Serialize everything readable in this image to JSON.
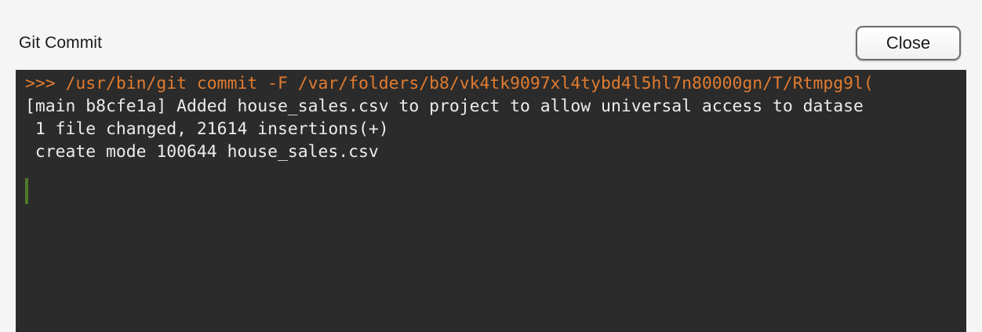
{
  "window": {
    "title": "Git Commit",
    "close_label": "Close"
  },
  "console": {
    "lines": [
      ">>> /usr/bin/git commit -F /var/folders/b8/vk4tk9097xl4tybd4l5hl7n80000gn/T/Rtmpg9l(",
      "[main b8cfe1a] Added house_sales.csv to project to allow universal access to datase",
      " 1 file changed, 21614 insertions(+)",
      " create mode 100644 house_sales.csv"
    ],
    "colors": {
      "background": "#2b2b2b",
      "command": "#e07b30",
      "output": "#ececec",
      "cursor": "#4e7a28"
    }
  }
}
